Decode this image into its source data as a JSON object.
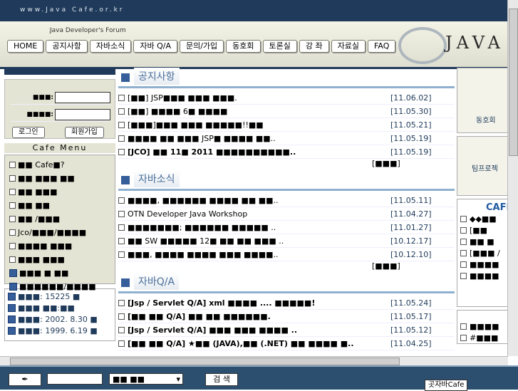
{
  "site_url": "www.Java Cafe.or.kr",
  "forum_title": "Java Developer's Forum",
  "logo_text": "JAVA",
  "nav": [
    "HOME",
    "공지사항",
    "자바소식",
    "자바 Q/A",
    "문의/가입",
    "동호회",
    "토론실",
    "강 좌",
    "자료실",
    "FAQ"
  ],
  "login": {
    "id_label": "■■■:",
    "pw_label": "■■■■:",
    "login_button": "로그인",
    "join_button": "회원가입"
  },
  "menu_title": "Cafe Menu",
  "menu": [
    "■■ Cafe■?",
    "■■ ■■■ ■■",
    "■■ ■■■",
    "■■ ■■",
    "■■ /■■■",
    "Jco/■■■/■■■■",
    "■■■■ ■■■",
    "■■■ ■■■",
    "■■■ ■ ■■",
    "■■■■■■/■■■■"
  ],
  "stats": [
    "■■■: 15225 ■",
    "■■■ ■■:■■",
    "■■■: 2002. 8.30 ■",
    "■■■: 1999. 6.19 ■"
  ],
  "sections": [
    {
      "title": "공지사항",
      "rows": [
        {
          "text": "[■■] JSP■■■ ■■■ ■■■.",
          "date": "[11.06.02]",
          "bold": false
        },
        {
          "text": "[■■] ■■■■ 6■ ■■■■",
          "date": "[11.05.30]",
          "bold": false
        },
        {
          "text": "[■■■]■■■ ■■■ ■■■■■!!■■",
          "date": "[11.05.21]",
          "bold": false
        },
        {
          "text": "■■■■ ■■ ■■■ JSP■ ■■■■ ■■..",
          "date": "[11.05.19]",
          "bold": false
        },
        {
          "text": "[JCO] ■■ 11■ 2011 ■■■■■■■■■■..",
          "date": "[11.05.19]",
          "bold": true
        }
      ],
      "more": "[■■■]"
    },
    {
      "title": "자바소식",
      "rows": [
        {
          "text": "■■■■, ■■■■■■ ■■■■ ■■ ■■..",
          "date": "[11.05.11]",
          "bold": false
        },
        {
          "text": "OTN Developer Java Workshop",
          "date": "[11.04.27]",
          "bold": false
        },
        {
          "text": "■■■■■■■; ■■■■■■ ■■■■■ ..",
          "date": "[11.01.27]",
          "bold": false
        },
        {
          "text": "■■ SW ■■■■■ 12■ ■■ ■■ ■■■ ..",
          "date": "[10.12.17]",
          "bold": false
        },
        {
          "text": "■■■, ■■■■ ■■■■ ■■■ ■■■■..",
          "date": "[10.12.10]",
          "bold": false
        }
      ],
      "more": "[■■■]"
    },
    {
      "title": "자바Q/A",
      "rows": [
        {
          "text": "[Jsp / Servlet Q/A] xml ■■■■ .... ■■■■■!",
          "date": "[11.05.24]",
          "bold": true
        },
        {
          "text": "[■■ ■■ Q/A] ■■ ■■ ■■■■■■.",
          "date": "[11.05.17]",
          "bold": true
        },
        {
          "text": "[Jsp / Servlet Q/A] ■■■ ■■■ ■■■■ ..",
          "date": "[11.05.12]",
          "bold": true
        },
        {
          "text": "[■■ ■■ Q/A] ★■■ (JAVA),■■ (.NET) ■■ ■■■■ ■..",
          "date": "[11.04.25]",
          "bold": true
        }
      ],
      "more": ""
    }
  ],
  "right": {
    "link1": "동호회",
    "link2": "팀프로젝",
    "cafe_title": "CAFE",
    "items": [
      "◆◆■■",
      "[■■",
      "■■ ■",
      "[■■■ /",
      "■■■■",
      "■■■■"
    ],
    "items2": [
      "■■■■",
      "#■■■"
    ]
  },
  "bottom": {
    "select_value": "■■ ■■",
    "search_button": "검 색",
    "pc_label": "곳자바Cafe"
  }
}
